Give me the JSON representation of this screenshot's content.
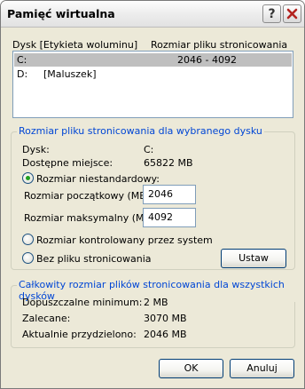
{
  "window": {
    "title": "Pamięć wirtualna"
  },
  "titlebar": {
    "help_glyph": "?",
    "close_icon": "close-icon"
  },
  "list": {
    "header_drive": "Dysk [Etykieta woluminu]",
    "header_size": "Rozmiar pliku stronicowania (MB)",
    "rows": [
      {
        "drive": "C:",
        "label": "",
        "size": "2046 - 4092",
        "selected": true
      },
      {
        "drive": "D:",
        "label": "[Maluszek]",
        "size": "",
        "selected": false
      }
    ]
  },
  "selected_drive": {
    "legend": "Rozmiar pliku stronicowania dla wybranego dysku",
    "drive_label": "Dysk:",
    "drive_value": "C:",
    "space_label": "Dostępne miejsce:",
    "space_value": "65822  MB",
    "custom_size_label": "Rozmiar niestandardowy:",
    "initial_label": "Rozmiar początkowy (MB):",
    "initial_value": "2046",
    "max_label": "Rozmiar maksymalny (MB):",
    "max_value": "4092",
    "system_managed_label": "Rozmiar kontrolowany przez system",
    "no_paging_label": "Bez pliku stronicowania",
    "set_button": "Ustaw",
    "selected_option": "custom"
  },
  "totals": {
    "legend": "Całkowity rozmiar plików stronicowania dla wszystkich dysków",
    "min_label": "Dopuszczalne minimum:",
    "min_value": "2  MB",
    "recommended_label": "Zalecane:",
    "recommended_value": "3070  MB",
    "allocated_label": "Aktualnie przydzielono:",
    "allocated_value": "2046  MB"
  },
  "footer": {
    "ok": "OK",
    "cancel": "Anuluj"
  },
  "colors": {
    "accent_blue": "#0046d5",
    "selection_gray": "#bfbfbf",
    "dialog_bg": "#ece9d8"
  }
}
